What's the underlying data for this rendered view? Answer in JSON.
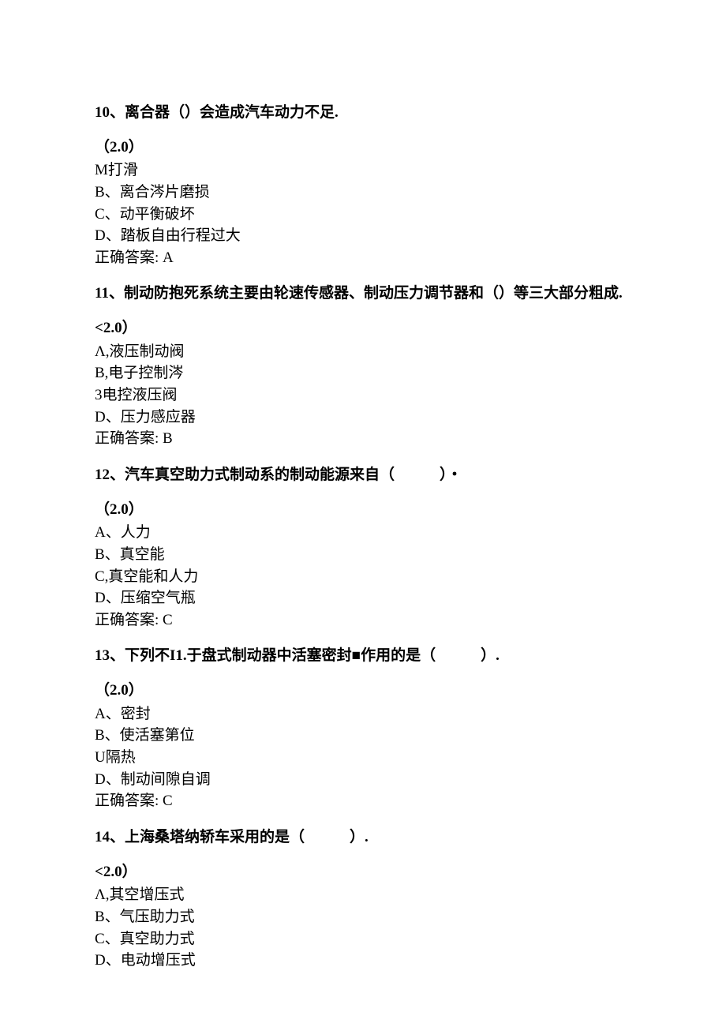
{
  "questions": [
    {
      "num": "10",
      "title": "、离合器（）会造成汽车动力不足.",
      "score": "（2.0）",
      "options": [
        "M打滑",
        "B、离合涔片磨损",
        "C、动平衡破坏",
        "D、踏板自由行程过大"
      ],
      "answer_label": "正确答案: ",
      "answer": "A"
    },
    {
      "num": "11",
      "title": "、制动防抱死系统主要由轮速传感器、制动压力调节器和（）等三大部分粗成.",
      "score": "<2.0）",
      "options": [
        "Λ,液压制动阀",
        "B,电子控制涔",
        "3电控液压阀",
        "D、压力感应器"
      ],
      "answer_label": "正确答案: ",
      "answer": "B"
    },
    {
      "num": "12",
      "title": "、汽车真空助力式制动系的制动能源来自（　　　）・",
      "score": "（2.0）",
      "options": [
        "A、人力",
        "B、真空能",
        "C,真空能和人力",
        "D、压缩空气瓶"
      ],
      "answer_label": "正确答案: ",
      "answer": "C"
    },
    {
      "num": "13",
      "title": "、下列不I1.于盘式制动器中活塞密封■作用的是（　　　）.",
      "score": "（2.0）",
      "options": [
        "A、密封",
        "B、使活塞第位",
        "U隔热",
        "D、制动间隙自调"
      ],
      "answer_label": "正确答案: ",
      "answer": "C"
    },
    {
      "num": "14",
      "title": "、上海桑塔纳轿车采用的是（　　　）.",
      "score": "<2.0）",
      "options": [
        "Λ,其空增压式",
        "B、气压助力式",
        "C、真空助力式",
        "D、电动增压式"
      ],
      "answer_label": "",
      "answer": ""
    }
  ]
}
